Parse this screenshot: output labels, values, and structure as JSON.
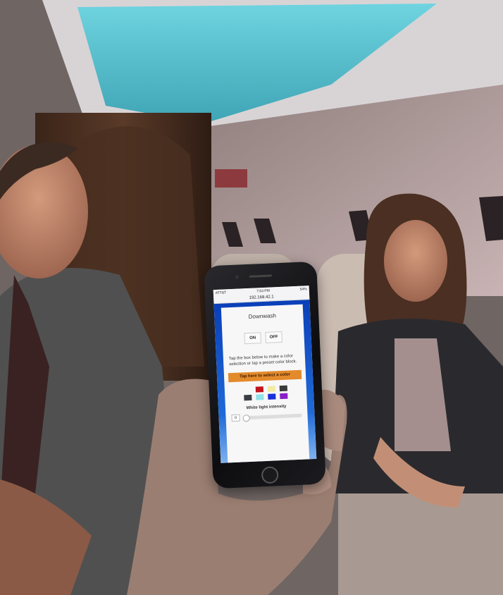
{
  "status": {
    "carrier": "ATT&T",
    "time": "7:53 PM",
    "battery": "54%"
  },
  "browser": {
    "url": "192.168.42.1"
  },
  "app": {
    "title": "Downwash",
    "on_label": "ON",
    "off_label": "OFF",
    "instructions": "Tap the box below to make a color selection or tap a preset color block.",
    "select_color_label": "Tap here to select a color",
    "preset_colors": [
      "#c3121c",
      "#f1eba6",
      "#3a3a3a",
      "#3a3d44",
      "#8fe2e8",
      "#1b2fd8",
      "#8a1fc8"
    ],
    "white_light_label": "White light intensity",
    "white_light_value": "0",
    "white_light_level": 0
  }
}
